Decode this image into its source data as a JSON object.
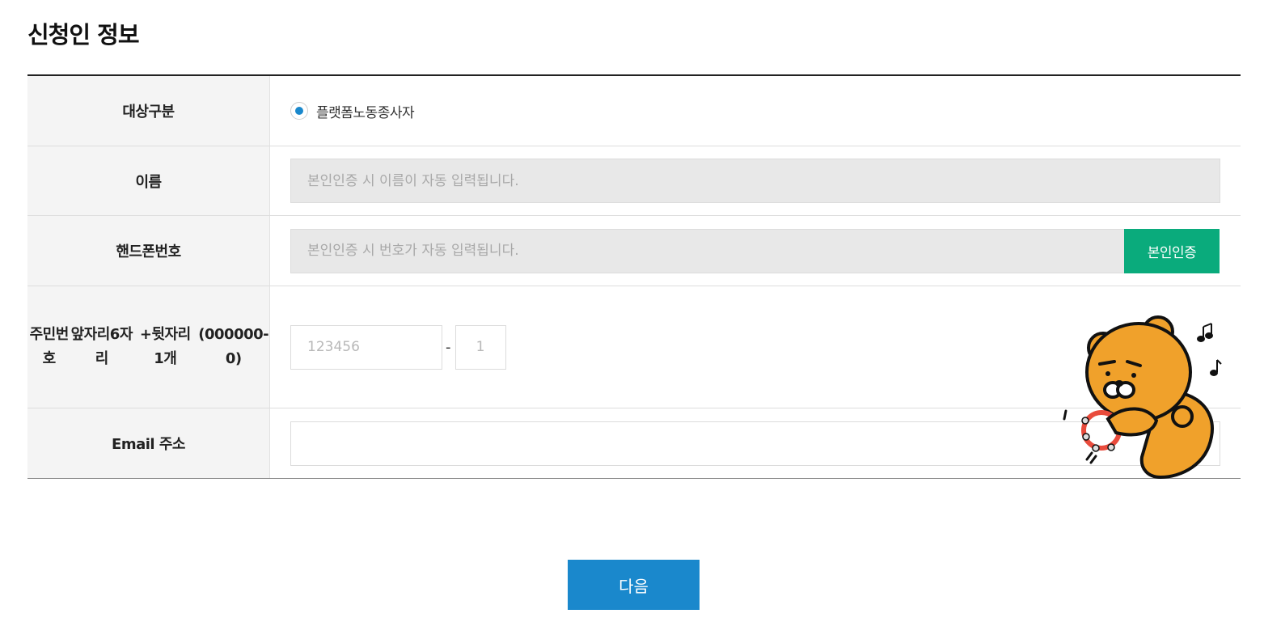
{
  "page": {
    "title": "신청인 정보"
  },
  "form": {
    "target": {
      "label": "대상구분",
      "option": "플랫폼노동종사자",
      "selected": true
    },
    "name": {
      "label": "이름",
      "placeholder": "본인인증 시 이름이 자동 입력됩니다."
    },
    "phone": {
      "label": "핸드폰번호",
      "placeholder": "본인인증 시 번호가 자동 입력됩니다.",
      "verify_button": "본인인증"
    },
    "rrn": {
      "label_lines": [
        "주민번호",
        "앞자리6자리",
        "+뒷자리 1개",
        "(000000-0)"
      ],
      "front_placeholder": "123456",
      "separator": "-",
      "back_placeholder": "1"
    },
    "email": {
      "label": "Email 주소",
      "value": ""
    }
  },
  "actions": {
    "next_label": "다음"
  },
  "colors": {
    "primary": "#1a88cc",
    "verify": "#0aab7c",
    "mascot": "#f0a12b"
  },
  "icons": {
    "mascot": "lion-mascot-tambourine-icon"
  }
}
